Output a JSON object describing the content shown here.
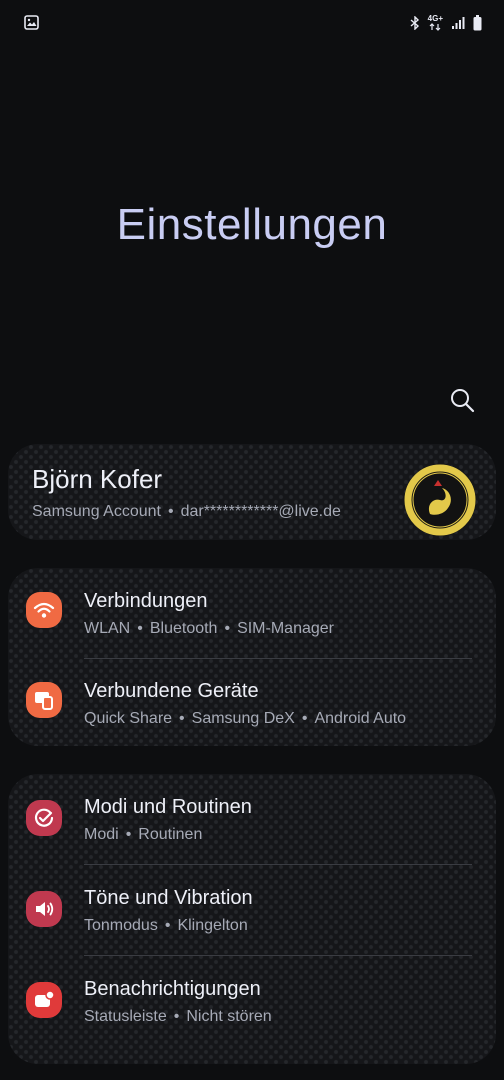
{
  "status_bar": {
    "network": "4G+"
  },
  "page": {
    "title": "Einstellungen"
  },
  "account": {
    "name": "Björn Kofer",
    "service": "Samsung Account",
    "separator": "•",
    "email": "dar************@live.de"
  },
  "groups": [
    {
      "items": [
        {
          "title": "Verbindungen",
          "subtitles": [
            "WLAN",
            "Bluetooth",
            "SIM-Manager"
          ],
          "icon": "wifi-icon",
          "color": "#f06a43"
        },
        {
          "title": "Verbundene Geräte",
          "subtitles": [
            "Quick Share",
            "Samsung DeX",
            "Android Auto"
          ],
          "icon": "connected-devices-icon",
          "color": "#f06a43"
        }
      ]
    },
    {
      "items": [
        {
          "title": "Modi und Routinen",
          "subtitles": [
            "Modi",
            "Routinen"
          ],
          "icon": "modes-routines-icon",
          "color": "#c0394f"
        },
        {
          "title": "Töne und Vibration",
          "subtitles": [
            "Tonmodus",
            "Klingelton"
          ],
          "icon": "speaker-icon",
          "color": "#c0394f"
        },
        {
          "title": "Benachrichtigungen",
          "subtitles": [
            "Statusleiste",
            "Nicht stören"
          ],
          "icon": "notification-icon",
          "color": "#e03a3a"
        }
      ]
    }
  ]
}
